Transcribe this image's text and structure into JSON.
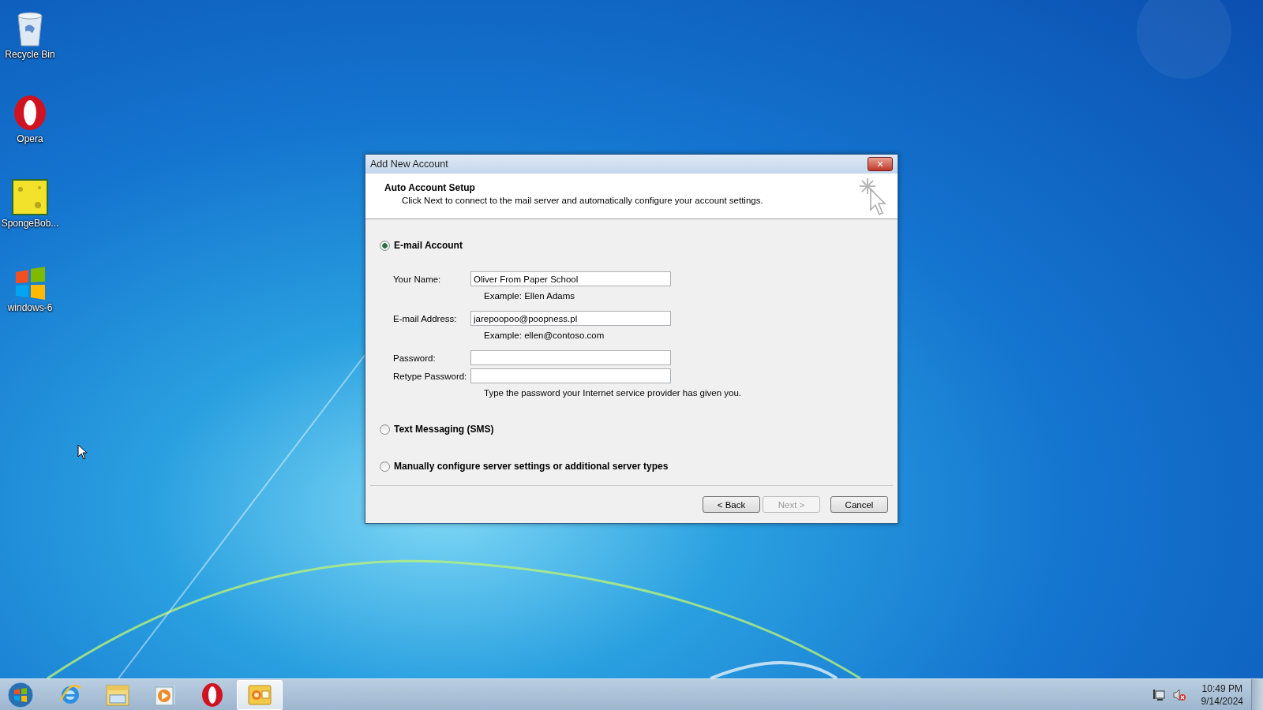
{
  "desktop_icons": [
    {
      "kind": "recycle",
      "label": "Recycle Bin"
    },
    {
      "kind": "opera",
      "label": "Opera"
    },
    {
      "kind": "sponge",
      "label": "SpongeBob..."
    },
    {
      "kind": "windows",
      "label": "windows-6"
    }
  ],
  "dialog": {
    "title": "Add New Account",
    "close": "✕",
    "header": {
      "title": "Auto Account Setup",
      "description": "Click Next to connect to the mail server and automatically configure your account settings."
    },
    "options": [
      {
        "label": "E-mail Account",
        "selected": true
      },
      {
        "label": "Text Messaging (SMS)",
        "selected": false
      },
      {
        "label": "Manually configure server settings or additional server types",
        "selected": false
      }
    ],
    "fields": [
      {
        "label": "Your Name:",
        "value": "Oliver From Paper School",
        "hint": "Example: Ellen Adams"
      },
      {
        "label": "E-mail Address:",
        "value": "jarepoopoo@poopness.pl",
        "hint": "Example: ellen@contoso.com"
      },
      {
        "label": "Password:"
      },
      {
        "label": "Retype Password:",
        "hint": "Type the password your Internet service provider has given you."
      }
    ],
    "buttons": [
      {
        "label": "< Back",
        "disabled": false
      },
      {
        "label": "Next >",
        "disabled": true
      },
      {
        "label": "Cancel",
        "disabled": false
      }
    ]
  },
  "taskbar": {
    "items": [
      {
        "kind": "ie",
        "selected": false
      },
      {
        "kind": "folder",
        "selected": false
      },
      {
        "kind": "media",
        "selected": false
      },
      {
        "kind": "opera",
        "selected": false
      },
      {
        "kind": "outlook",
        "selected": true
      }
    ],
    "clock": {
      "time": "10:49 PM",
      "date": "9/14/2024"
    }
  }
}
